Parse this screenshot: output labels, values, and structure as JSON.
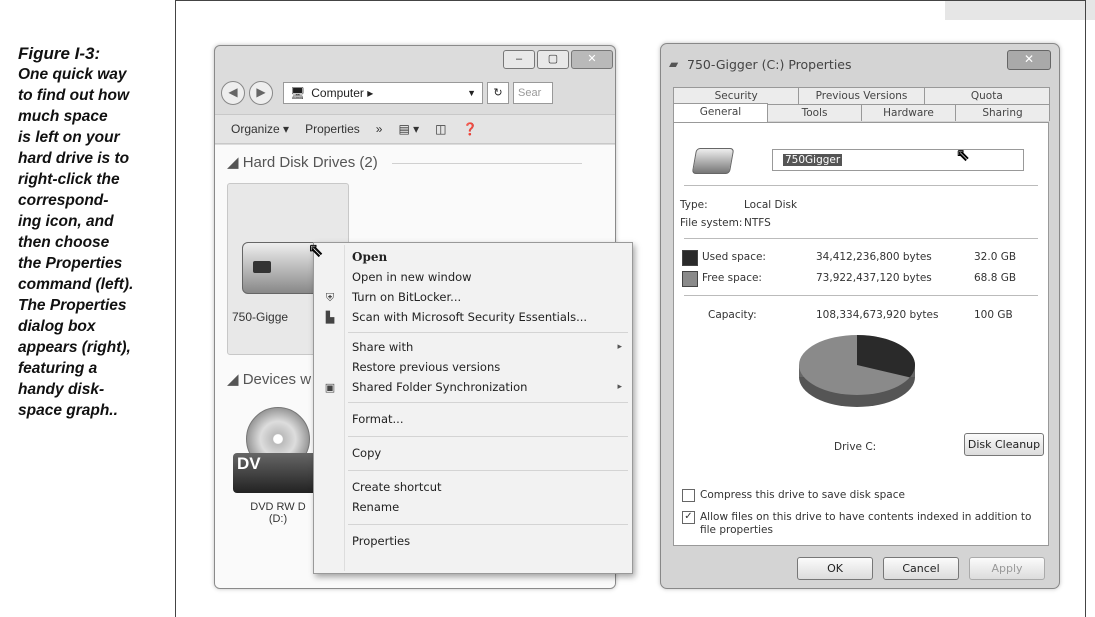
{
  "caption": {
    "figure": "Figure I-3:",
    "body": "One quick way\nto find out how\nmuch space\nis left on your\nhard drive is to\nright-click the\ncorrespond-\ning icon, and\nthen choose\nthe Properties\ncommand (left).\nThe Properties\ndialog box\nappears (right),\nfeaturing a\nhandy disk-\nspace graph.."
  },
  "explorer": {
    "breadcrumb": "Computer ▸",
    "search_placeholder": "Sear",
    "toolbar": {
      "organize": "Organize ▾",
      "properties": "Properties",
      "more": "»"
    },
    "groups": {
      "hard_disk": "Hard Disk Drives (2)",
      "devices": "Devices w"
    },
    "drives": {
      "c_label": "750-Gigge",
      "dvd_label": "DVD RW D\n(D:)",
      "dvd_text": "DV"
    }
  },
  "context_menu": {
    "items": [
      "Open",
      "Open in new window",
      "Turn on BitLocker...",
      "Scan with Microsoft Security Essentials...",
      "Share with",
      "Restore previous versions",
      "Shared Folder Synchronization",
      "Format...",
      "Copy",
      "Create shortcut",
      "Rename",
      "Properties"
    ]
  },
  "dialog": {
    "title": "750-Gigger (C:) Properties",
    "tabs_top": [
      "Security",
      "Previous Versions",
      "Quota"
    ],
    "tabs_bottom": [
      "General",
      "Tools",
      "Hardware",
      "Sharing"
    ],
    "name_value": "750Gigger",
    "type_label": "Type:",
    "type_value": "Local Disk",
    "fs_label": "File system:",
    "fs_value": "NTFS",
    "used_label": "Used space:",
    "used_bytes": "34,412,236,800 bytes",
    "used_gb": "32.0 GB",
    "free_label": "Free space:",
    "free_bytes": "73,922,437,120 bytes",
    "free_gb": "68.8 GB",
    "capacity_label": "Capacity:",
    "capacity_bytes": "108,334,673,920 bytes",
    "capacity_gb": "100 GB",
    "drive_label": "Drive C:",
    "cleanup_button": "Disk Cleanup",
    "compress_label": "Compress this drive to save disk space",
    "index_label": "Allow files on this drive to have contents indexed in addition to file properties",
    "ok_button": "OK",
    "cancel_button": "Cancel",
    "apply_button": "Apply",
    "colors": {
      "used": "#2a2a2a",
      "free": "#8a8a8a"
    }
  }
}
